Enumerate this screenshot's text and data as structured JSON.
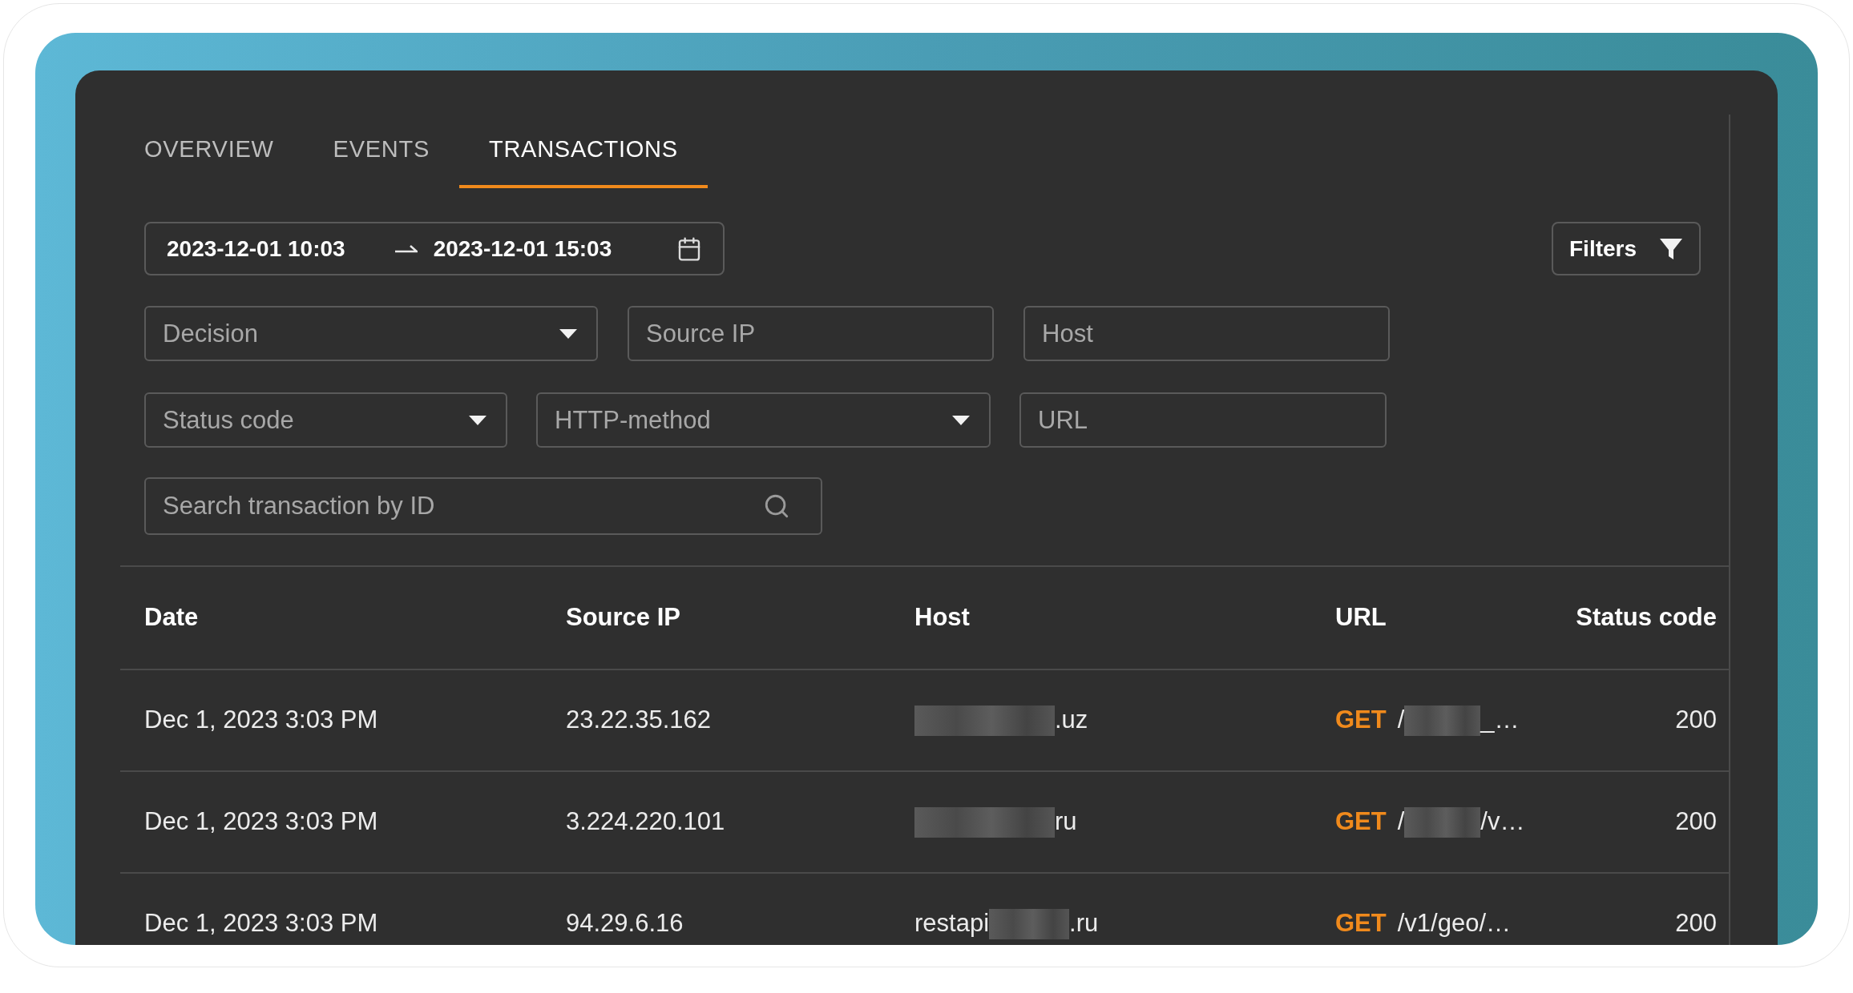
{
  "tabs": [
    {
      "label": "OVERVIEW",
      "selected": false
    },
    {
      "label": "EVENTS",
      "selected": false
    },
    {
      "label": "TRANSACTIONS",
      "selected": true
    }
  ],
  "date_range": {
    "start": "2023-12-01 10:03",
    "end": "2023-12-01 15:03"
  },
  "filters_button": "Filters",
  "filter_rows": [
    [
      {
        "kind": "select",
        "placeholder": "Decision"
      },
      {
        "kind": "text",
        "placeholder": "Source IP"
      },
      {
        "kind": "text",
        "placeholder": "Host"
      }
    ],
    [
      {
        "kind": "select",
        "placeholder": "Status code"
      },
      {
        "kind": "select",
        "placeholder": "HTTP-method"
      },
      {
        "kind": "text",
        "placeholder": "URL"
      }
    ]
  ],
  "search": {
    "placeholder": "Search transaction by ID"
  },
  "table": {
    "columns": [
      "Date",
      "Source IP",
      "Host",
      "URL",
      "Status code"
    ],
    "rows": [
      {
        "date": "Dec 1, 2023 3:03 PM",
        "source_ip": "23.22.35.162",
        "host": [
          {
            "kind": "redacted"
          },
          {
            "kind": "text",
            "text": ".uz"
          }
        ],
        "method": "GET",
        "url": [
          {
            "kind": "text",
            "text": "/"
          },
          {
            "kind": "redacted"
          },
          {
            "kind": "text",
            "text": "_…"
          }
        ],
        "status_code": "200"
      },
      {
        "date": "Dec 1, 2023 3:03 PM",
        "source_ip": "3.224.220.101",
        "host": [
          {
            "kind": "redacted"
          },
          {
            "kind": "text",
            "text": "ru"
          }
        ],
        "method": "GET",
        "url": [
          {
            "kind": "text",
            "text": "/"
          },
          {
            "kind": "redacted"
          },
          {
            "kind": "text",
            "text": "/v…"
          }
        ],
        "status_code": "200"
      },
      {
        "date": "Dec 1, 2023 3:03 PM",
        "source_ip": "94.29.6.16",
        "host": [
          {
            "kind": "text",
            "text": "restapi"
          },
          {
            "kind": "redacted"
          },
          {
            "kind": "text",
            "text": ".ru"
          }
        ],
        "method": "GET",
        "url": [
          {
            "kind": "text",
            "text": "/v1/geo/…"
          }
        ],
        "status_code": "200"
      }
    ]
  }
}
